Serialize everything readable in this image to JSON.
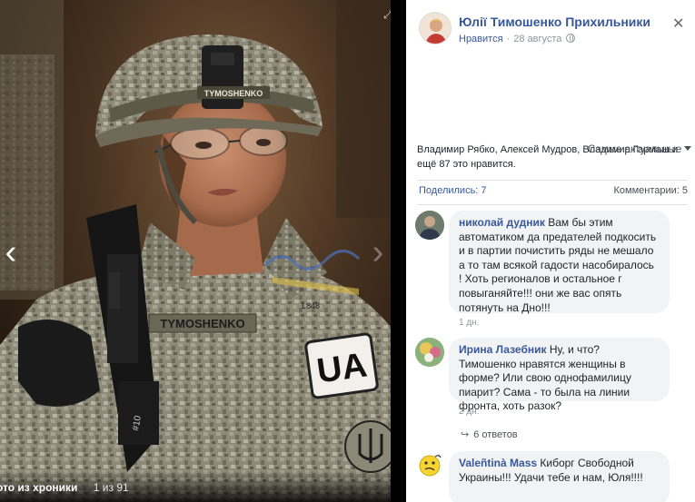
{
  "photo": {
    "helmet_tape": "TYMOSHENKO",
    "name_tape": "TYMOSHENKO",
    "patch_text": "UA",
    "patch_code": "L848",
    "rifle_mark": "#10",
    "album_label": "ото из хроники",
    "counter": "1 из 91",
    "prev_icon": "chevron-left-icon",
    "next_icon": "chevron-right-icon"
  },
  "post": {
    "page_name": "Юлії Тимошенко Прихильники",
    "like_link": "Нравится",
    "date": "28 августа",
    "likes_text": "Владимир Рябко, Алексей Мудров, Владимир Гармаш и ещё 87 это нравится.",
    "sort_label": "Самые актуальные",
    "shares_label": "Поделились: 7",
    "comments_count_label": "Комментарии: 5"
  },
  "comments": [
    {
      "author": "николай дудник",
      "text": "Вам бы этим автоматиком да предателей подкосить и в партии почистить ряды не мешало а то там всякой гадости насобиралось ! Хоть регионалов и остальное г повыганяйте!!! они же вас опять потянуть на Дно!!!",
      "time": "1 дн."
    },
    {
      "author": "Ирина Лазебник",
      "text": "Ну, и что? Тимошенко нравятся женщины в форме? Или свою однофамилицу пиарит? Сама - то была на линии фронта, хоть разок?",
      "time": "2 дн.",
      "replies_label": "6 ответов"
    },
    {
      "author": "Valeñtinà Mass",
      "text": "Киборг Свободной Украины!!! Удачи тебе и нам, Юля!!!!"
    }
  ],
  "colors": {
    "link_blue": "#385898",
    "meta_gray": "#90949c",
    "bubble_bg": "#f2f3f5",
    "camo_base": "#8f8a78"
  }
}
